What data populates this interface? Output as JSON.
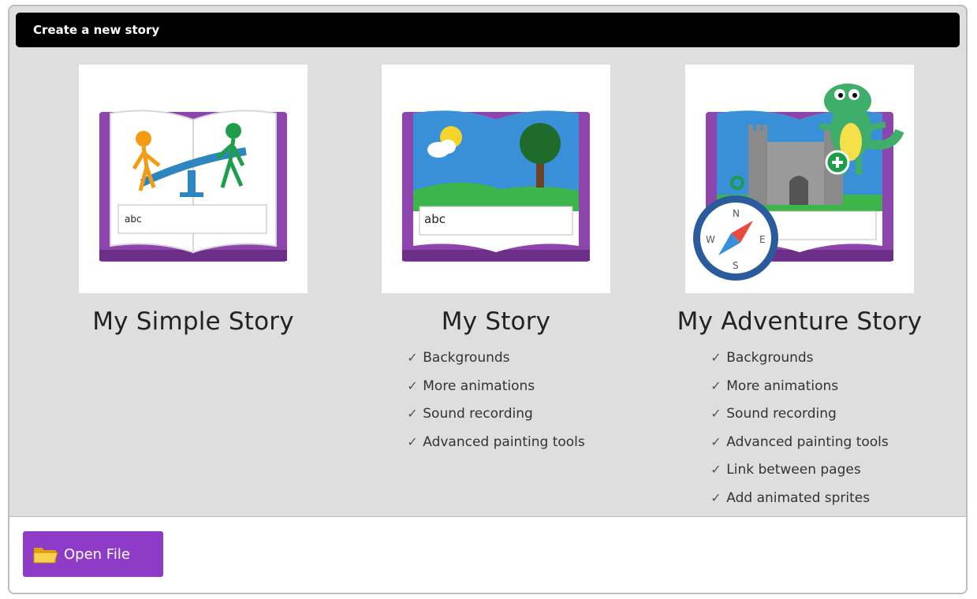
{
  "dialog": {
    "title": "Create a new story"
  },
  "colors": {
    "title_bar": "#000000",
    "dialog_bg": "#dedede",
    "book_cover": "#8e44ad",
    "button_bg": "#8e3cc8"
  },
  "cards": [
    {
      "title": "My Simple Story",
      "thumbnail_icon": "simple-story-book-icon",
      "page_text": "abc",
      "features": []
    },
    {
      "title": "My Story",
      "thumbnail_icon": "story-book-icon",
      "page_text": "abc",
      "features": [
        "Backgrounds",
        "More animations",
        "Sound recording",
        "Advanced painting tools"
      ]
    },
    {
      "title": "My Adventure Story",
      "thumbnail_icon": "adventure-story-book-icon",
      "compass_letters": [
        "N",
        "E",
        "S",
        "W"
      ],
      "features": [
        "Backgrounds",
        "More animations",
        "Sound recording",
        "Advanced painting tools",
        "Link between pages",
        "Add animated sprites"
      ]
    }
  ],
  "tick_glyph": "✓",
  "footer": {
    "open_button_label": "Open File",
    "open_button_icon": "folder-icon"
  }
}
